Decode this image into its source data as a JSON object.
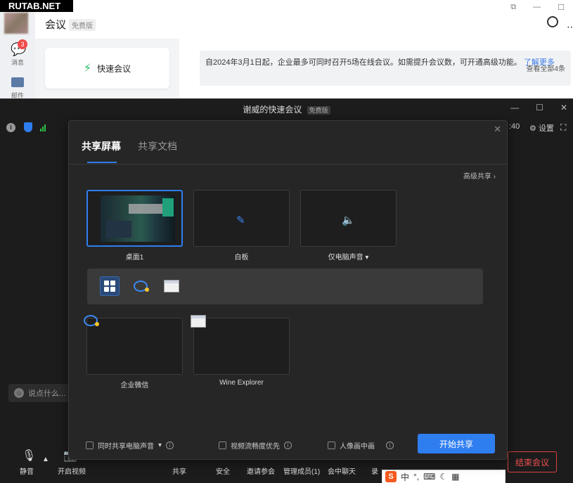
{
  "watermark": "RUTAB.NET",
  "background_app": {
    "title": "会议",
    "edition_tag": "免费版",
    "sidebar": {
      "messages_label": "消息",
      "messages_badge": "3",
      "mail_label": "邮件"
    },
    "quick_meeting_label": "快速会议",
    "notice": {
      "text": "自2024年3月1日起，企业最多可同时召开5场在线会议。如需提升会议数，可开通高级功能。",
      "link": "了解更多",
      "view_all": "查看全部4条"
    }
  },
  "meeting": {
    "title": "谢威的快速会议",
    "edition_tag": "免费版",
    "timer_fragment": ":40",
    "settings_label": "设置",
    "chat_placeholder": "说点什么...",
    "toolbar": {
      "mute": "静音",
      "video": "开启视频",
      "share": "共享",
      "security": "安全",
      "invite": "邀请参会",
      "manage_members": "管理成员(1)",
      "chat": "会中聊天",
      "record": "录",
      "end_meeting": "结束会议"
    },
    "ime": {
      "logo": "S",
      "mode": "中"
    }
  },
  "share_dialog": {
    "tabs": [
      {
        "label": "共享屏幕",
        "active": true
      },
      {
        "label": "共享文档",
        "active": false
      }
    ],
    "advanced_share": "高级共享 ›",
    "sources": [
      {
        "label": "桌面1",
        "selected": true
      },
      {
        "label": "白板",
        "selected": false
      },
      {
        "label": "仅电脑声音 ▾",
        "selected": false
      }
    ],
    "app_windows": [
      {
        "label": "企业微信"
      },
      {
        "label": "Wine Explorer"
      }
    ],
    "options": {
      "share_audio": "同时共享电脑声音",
      "video_smooth": "视频流畅度优先",
      "pip": "人像画中画"
    },
    "start_button": "开始共享"
  },
  "colors": {
    "accent": "#2f7ef0",
    "danger": "#e04040",
    "dialog_bg": "#262626",
    "meeting_bg": "#1c1c1c"
  }
}
